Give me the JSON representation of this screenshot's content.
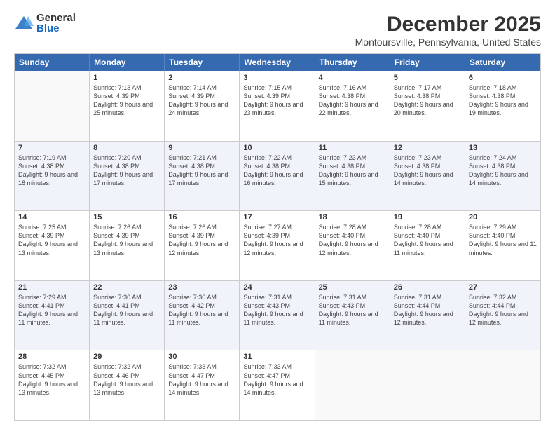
{
  "logo": {
    "general": "General",
    "blue": "Blue"
  },
  "title": "December 2025",
  "location": "Montoursville, Pennsylvania, United States",
  "days": [
    "Sunday",
    "Monday",
    "Tuesday",
    "Wednesday",
    "Thursday",
    "Friday",
    "Saturday"
  ],
  "weeks": [
    [
      {
        "day": "",
        "empty": true
      },
      {
        "day": "1",
        "sunrise": "7:13 AM",
        "sunset": "4:39 PM",
        "daylight": "9 hours and 25 minutes."
      },
      {
        "day": "2",
        "sunrise": "7:14 AM",
        "sunset": "4:39 PM",
        "daylight": "9 hours and 24 minutes."
      },
      {
        "day": "3",
        "sunrise": "7:15 AM",
        "sunset": "4:39 PM",
        "daylight": "9 hours and 23 minutes."
      },
      {
        "day": "4",
        "sunrise": "7:16 AM",
        "sunset": "4:38 PM",
        "daylight": "9 hours and 22 minutes."
      },
      {
        "day": "5",
        "sunrise": "7:17 AM",
        "sunset": "4:38 PM",
        "daylight": "9 hours and 20 minutes."
      },
      {
        "day": "6",
        "sunrise": "7:18 AM",
        "sunset": "4:38 PM",
        "daylight": "9 hours and 19 minutes."
      }
    ],
    [
      {
        "day": "7",
        "sunrise": "7:19 AM",
        "sunset": "4:38 PM",
        "daylight": "9 hours and 18 minutes."
      },
      {
        "day": "8",
        "sunrise": "7:20 AM",
        "sunset": "4:38 PM",
        "daylight": "9 hours and 17 minutes."
      },
      {
        "day": "9",
        "sunrise": "7:21 AM",
        "sunset": "4:38 PM",
        "daylight": "9 hours and 17 minutes."
      },
      {
        "day": "10",
        "sunrise": "7:22 AM",
        "sunset": "4:38 PM",
        "daylight": "9 hours and 16 minutes."
      },
      {
        "day": "11",
        "sunrise": "7:23 AM",
        "sunset": "4:38 PM",
        "daylight": "9 hours and 15 minutes."
      },
      {
        "day": "12",
        "sunrise": "7:23 AM",
        "sunset": "4:38 PM",
        "daylight": "9 hours and 14 minutes."
      },
      {
        "day": "13",
        "sunrise": "7:24 AM",
        "sunset": "4:38 PM",
        "daylight": "9 hours and 14 minutes."
      }
    ],
    [
      {
        "day": "14",
        "sunrise": "7:25 AM",
        "sunset": "4:39 PM",
        "daylight": "9 hours and 13 minutes."
      },
      {
        "day": "15",
        "sunrise": "7:26 AM",
        "sunset": "4:39 PM",
        "daylight": "9 hours and 13 minutes."
      },
      {
        "day": "16",
        "sunrise": "7:26 AM",
        "sunset": "4:39 PM",
        "daylight": "9 hours and 12 minutes."
      },
      {
        "day": "17",
        "sunrise": "7:27 AM",
        "sunset": "4:39 PM",
        "daylight": "9 hours and 12 minutes."
      },
      {
        "day": "18",
        "sunrise": "7:28 AM",
        "sunset": "4:40 PM",
        "daylight": "9 hours and 12 minutes."
      },
      {
        "day": "19",
        "sunrise": "7:28 AM",
        "sunset": "4:40 PM",
        "daylight": "9 hours and 11 minutes."
      },
      {
        "day": "20",
        "sunrise": "7:29 AM",
        "sunset": "4:40 PM",
        "daylight": "9 hours and 11 minutes."
      }
    ],
    [
      {
        "day": "21",
        "sunrise": "7:29 AM",
        "sunset": "4:41 PM",
        "daylight": "9 hours and 11 minutes."
      },
      {
        "day": "22",
        "sunrise": "7:30 AM",
        "sunset": "4:41 PM",
        "daylight": "9 hours and 11 minutes."
      },
      {
        "day": "23",
        "sunrise": "7:30 AM",
        "sunset": "4:42 PM",
        "daylight": "9 hours and 11 minutes."
      },
      {
        "day": "24",
        "sunrise": "7:31 AM",
        "sunset": "4:43 PM",
        "daylight": "9 hours and 11 minutes."
      },
      {
        "day": "25",
        "sunrise": "7:31 AM",
        "sunset": "4:43 PM",
        "daylight": "9 hours and 11 minutes."
      },
      {
        "day": "26",
        "sunrise": "7:31 AM",
        "sunset": "4:44 PM",
        "daylight": "9 hours and 12 minutes."
      },
      {
        "day": "27",
        "sunrise": "7:32 AM",
        "sunset": "4:44 PM",
        "daylight": "9 hours and 12 minutes."
      }
    ],
    [
      {
        "day": "28",
        "sunrise": "7:32 AM",
        "sunset": "4:45 PM",
        "daylight": "9 hours and 13 minutes."
      },
      {
        "day": "29",
        "sunrise": "7:32 AM",
        "sunset": "4:46 PM",
        "daylight": "9 hours and 13 minutes."
      },
      {
        "day": "30",
        "sunrise": "7:33 AM",
        "sunset": "4:47 PM",
        "daylight": "9 hours and 14 minutes."
      },
      {
        "day": "31",
        "sunrise": "7:33 AM",
        "sunset": "4:47 PM",
        "daylight": "9 hours and 14 minutes."
      },
      {
        "day": "",
        "empty": true
      },
      {
        "day": "",
        "empty": true
      },
      {
        "day": "",
        "empty": true
      }
    ]
  ]
}
